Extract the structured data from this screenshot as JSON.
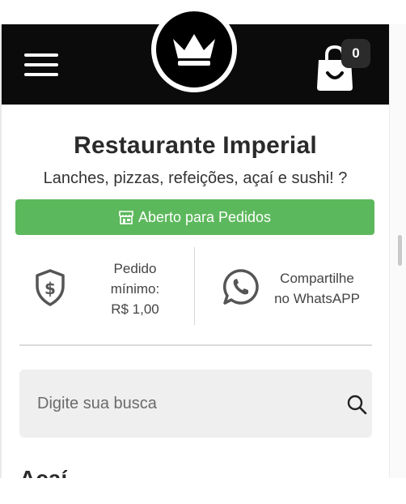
{
  "header": {
    "menu_label": "Menu",
    "cart_count": "0"
  },
  "restaurant": {
    "name": "Restaurante Imperial",
    "tagline": "Lanches, pizzas, refeições, açaí e sushi! ?",
    "status_label": "Aberto para Pedidos",
    "status_color": "#5cb85c"
  },
  "info": {
    "min_order_line1": "Pedido",
    "min_order_line2": "mínimo:",
    "min_order_value": "R$ 1,00",
    "share_line1": "Compartilhe",
    "share_line2": "no WhatsAPP"
  },
  "search": {
    "placeholder": "Digite sua busca"
  },
  "section": {
    "first_category": "Açaí"
  },
  "icons": [
    "menu-icon",
    "crown-icon",
    "shopping-bag-icon",
    "store-icon",
    "shield-dollar-icon",
    "whatsapp-icon",
    "search-icon"
  ],
  "colors": {
    "header_bg": "#0b0b0b",
    "accent_green": "#5cb85c",
    "search_bg": "#efefef"
  }
}
